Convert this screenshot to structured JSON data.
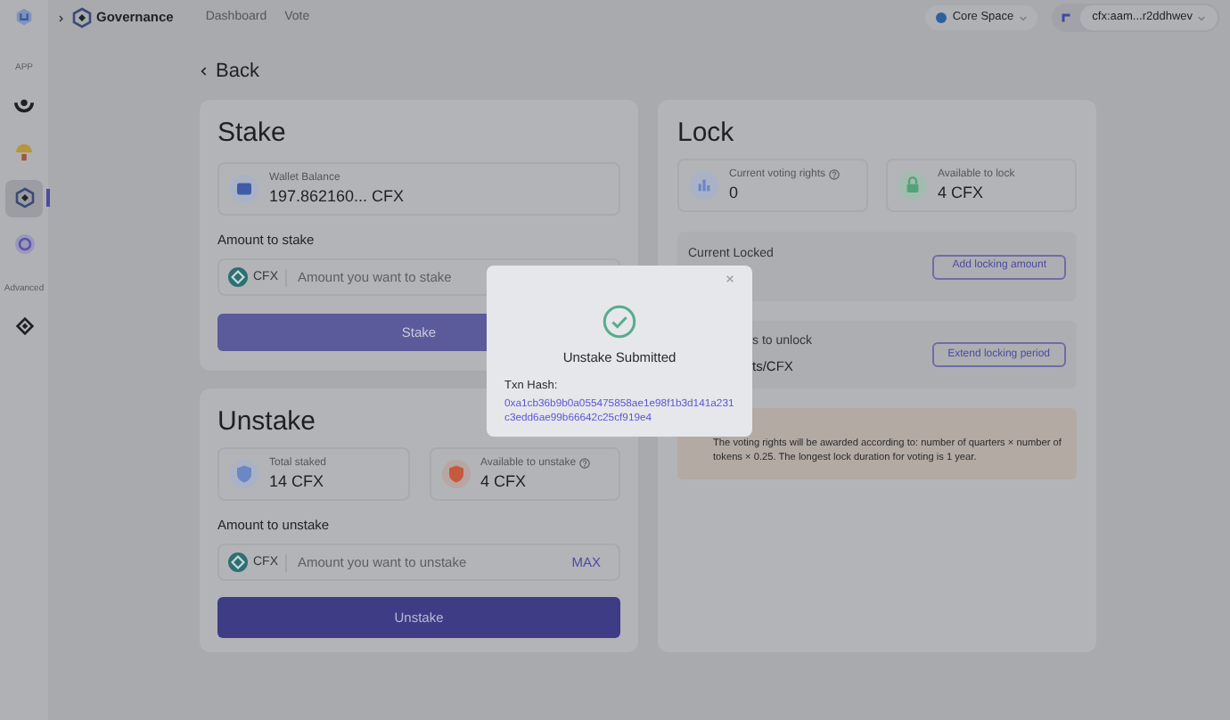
{
  "sidebar": {
    "sections": [
      {
        "label": "APP",
        "items": [
          {
            "selected": false
          },
          {
            "selected": false
          },
          {
            "selected": true
          },
          {
            "selected": false
          }
        ]
      },
      {
        "label": "Advanced",
        "items": [
          {
            "selected": false
          }
        ]
      }
    ]
  },
  "top_bar": {
    "brand": "Governance",
    "nav": [
      "Dashboard",
      "Vote"
    ],
    "network": "Core Space",
    "account": "cfx:aam...r2ddhwev"
  },
  "back": "Back",
  "stake": {
    "title": "Stake",
    "wallet_label": "Wallet Balance",
    "wallet_value": "197.862160... CFX",
    "amount_label": "Amount to stake",
    "token": "CFX",
    "placeholder": "Amount you want to stake",
    "button": "Stake"
  },
  "unstake": {
    "title": "Unstake",
    "stats": [
      {
        "label": "Total staked",
        "value": "14 CFX",
        "help": false
      },
      {
        "label": "Available to unstake",
        "value": "4 CFX",
        "help": true
      }
    ],
    "amount_label": "Amount to unstake",
    "token": "CFX",
    "placeholder": "Amount you want to unstake",
    "max": "MAX",
    "button": "Unstake"
  },
  "lock": {
    "title": "Lock",
    "stats": [
      {
        "label": "Current voting rights",
        "value": "0",
        "help": true
      },
      {
        "label": "Available to lock",
        "value": "4 CFX",
        "help": false
      }
    ],
    "current_locked": {
      "label": "Current Locked",
      "button": "Add locking amount"
    },
    "periods": {
      "label": "s to unlock",
      "value": "ts/CFX",
      "button": "Extend locking period"
    },
    "info": "The voting rights will be awarded according to: number of quarters × number of tokens × 0.25. The longest lock duration for voting is 1 year."
  },
  "dialog": {
    "title": "Unstake Submitted",
    "hash_label": "Txn Hash:",
    "hash": "0xa1cb36b9b0a055475858ae1e98f1b3d141a231c3edd6ae99b66642c25cf919e4"
  }
}
